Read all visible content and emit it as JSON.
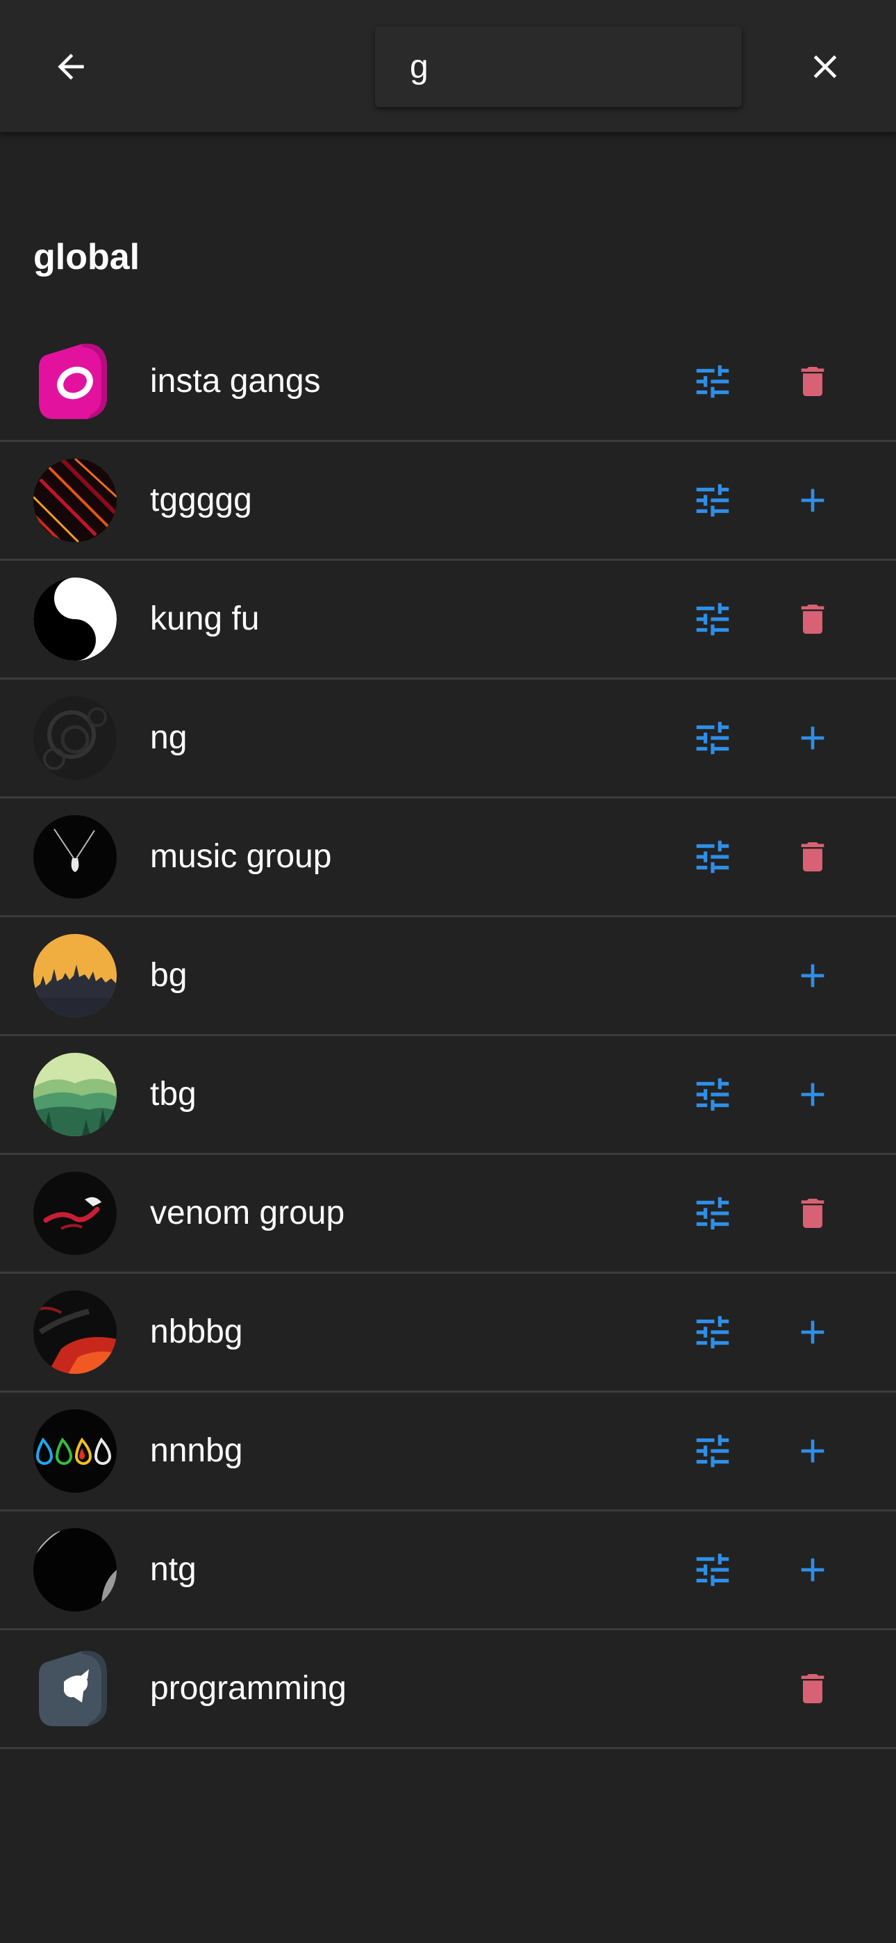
{
  "header": {
    "search_value": "g",
    "back_icon": "arrow-left-icon",
    "close_icon": "close-icon"
  },
  "section": {
    "title": "global"
  },
  "colors": {
    "background": "#222222",
    "app_bar": "#272727",
    "accent_blue": "#2f8fe8",
    "delete_red": "#d86273"
  },
  "groups": [
    {
      "name": "insta gangs",
      "settings": true,
      "action": "delete"
    },
    {
      "name": "tggggg",
      "settings": true,
      "action": "add"
    },
    {
      "name": "kung fu",
      "settings": true,
      "action": "delete"
    },
    {
      "name": "ng",
      "settings": true,
      "action": "add"
    },
    {
      "name": "music group",
      "settings": true,
      "action": "delete"
    },
    {
      "name": "bg",
      "settings": false,
      "action": "add"
    },
    {
      "name": "tbg",
      "settings": true,
      "action": "add"
    },
    {
      "name": "venom group",
      "settings": true,
      "action": "delete"
    },
    {
      "name": "nbbbg",
      "settings": true,
      "action": "add"
    },
    {
      "name": "nnnbg",
      "settings": true,
      "action": "add"
    },
    {
      "name": "ntg",
      "settings": true,
      "action": "add"
    },
    {
      "name": "programming",
      "settings": false,
      "action": "delete"
    }
  ]
}
